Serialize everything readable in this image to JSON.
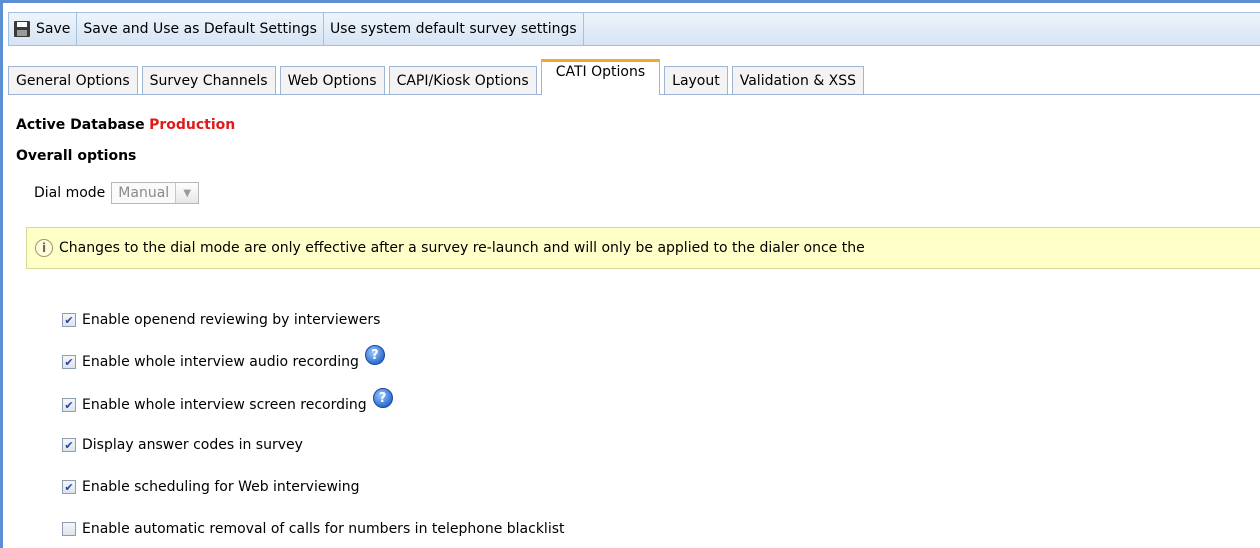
{
  "toolbar": {
    "save": "Save",
    "save_default": "Save and Use as Default Settings",
    "use_system": "Use system default survey settings"
  },
  "tabs": [
    {
      "label": "General Options"
    },
    {
      "label": "Survey Channels"
    },
    {
      "label": "Web Options"
    },
    {
      "label": "CAPI/Kiosk Options"
    },
    {
      "label": "CATI Options",
      "active": true
    },
    {
      "label": "Layout"
    },
    {
      "label": "Validation & XSS"
    }
  ],
  "active_db": {
    "label": "Active Database",
    "value": "Production"
  },
  "overall_options": "Overall options",
  "dial_mode": {
    "label": "Dial mode",
    "value": "Manual"
  },
  "notice": "Changes to the dial mode are only effective after a survey re-launch and will only be applied to the dialer once the",
  "options": [
    {
      "label": "Enable openend reviewing by interviewers",
      "checked": true
    },
    {
      "label": "Enable whole interview audio recording",
      "checked": true,
      "help": true
    },
    {
      "label": "Enable whole interview screen recording",
      "checked": true,
      "help": true
    },
    {
      "label": "Display answer codes in survey",
      "checked": true
    },
    {
      "label": "Enable scheduling for Web interviewing",
      "checked": true
    },
    {
      "label": "Enable automatic removal of calls for numbers in telephone blacklist",
      "checked": false
    }
  ],
  "colors": {
    "accent": "#5b8fd3",
    "active_tab": "#f0a830",
    "production": "#e01a1a",
    "notice_bg": "#ffffc8"
  }
}
